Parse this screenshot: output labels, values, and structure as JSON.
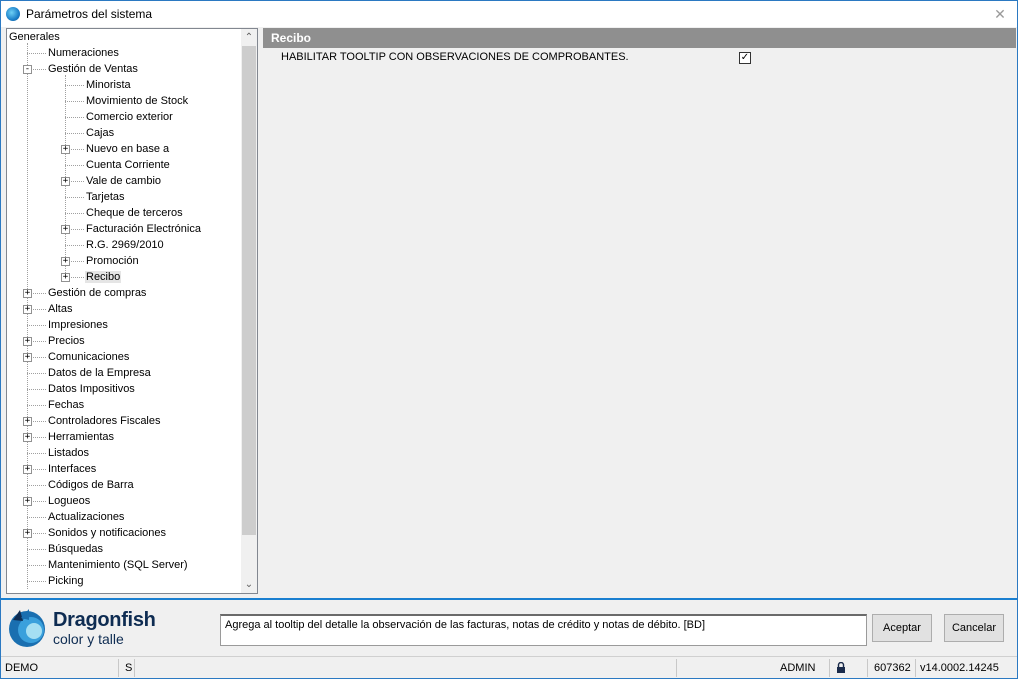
{
  "window": {
    "title": "Parámetros del sistema",
    "close_glyph": "✕"
  },
  "tree": {
    "root": "Generales",
    "items": [
      {
        "label": "Numeraciones",
        "level": 1,
        "expander": ""
      },
      {
        "label": "Gestión de Ventas",
        "level": 1,
        "expander": "−"
      },
      {
        "label": "Minorista",
        "level": 2,
        "expander": ""
      },
      {
        "label": "Movimiento de Stock",
        "level": 2,
        "expander": ""
      },
      {
        "label": "Comercio exterior",
        "level": 2,
        "expander": ""
      },
      {
        "label": "Cajas",
        "level": 2,
        "expander": ""
      },
      {
        "label": "Nuevo en base a",
        "level": 2,
        "expander": "+"
      },
      {
        "label": "Cuenta Corriente",
        "level": 2,
        "expander": ""
      },
      {
        "label": "Vale de cambio",
        "level": 2,
        "expander": "+"
      },
      {
        "label": "Tarjetas",
        "level": 2,
        "expander": ""
      },
      {
        "label": "Cheque de terceros",
        "level": 2,
        "expander": ""
      },
      {
        "label": "Facturación Electrónica",
        "level": 2,
        "expander": "+"
      },
      {
        "label": "R.G. 2969/2010",
        "level": 2,
        "expander": ""
      },
      {
        "label": "Promoción",
        "level": 2,
        "expander": "+"
      },
      {
        "label": "Recibo",
        "level": 2,
        "expander": "+",
        "selected": true
      },
      {
        "label": "Gestión de compras",
        "level": 1,
        "expander": "+"
      },
      {
        "label": "Altas",
        "level": 1,
        "expander": "+"
      },
      {
        "label": "Impresiones",
        "level": 1,
        "expander": ""
      },
      {
        "label": "Precios",
        "level": 1,
        "expander": "+"
      },
      {
        "label": "Comunicaciones",
        "level": 1,
        "expander": "+"
      },
      {
        "label": "Datos de la Empresa",
        "level": 1,
        "expander": ""
      },
      {
        "label": "Datos Impositivos",
        "level": 1,
        "expander": ""
      },
      {
        "label": "Fechas",
        "level": 1,
        "expander": ""
      },
      {
        "label": "Controladores Fiscales",
        "level": 1,
        "expander": "+"
      },
      {
        "label": "Herramientas",
        "level": 1,
        "expander": "+"
      },
      {
        "label": "Listados",
        "level": 1,
        "expander": ""
      },
      {
        "label": "Interfaces",
        "level": 1,
        "expander": "+"
      },
      {
        "label": "Códigos de Barra",
        "level": 1,
        "expander": ""
      },
      {
        "label": "Logueos",
        "level": 1,
        "expander": "+"
      },
      {
        "label": "Actualizaciones",
        "level": 1,
        "expander": ""
      },
      {
        "label": "Sonidos y notificaciones",
        "level": 1,
        "expander": "+"
      },
      {
        "label": "Búsquedas",
        "level": 1,
        "expander": ""
      },
      {
        "label": "Mantenimiento (SQL Server)",
        "level": 1,
        "expander": ""
      },
      {
        "label": "Picking",
        "level": 1,
        "expander": ""
      }
    ],
    "scroll_up_glyph": "⌃",
    "scroll_down_glyph": "⌄"
  },
  "section": {
    "header": "Recibo",
    "option_label": "HABILITAR TOOLTIP CON OBSERVACIONES DE COMPROBANTES.",
    "option_checked": true,
    "check_glyph": "✓"
  },
  "footer": {
    "brand_name": "Dragonfish",
    "brand_sub": "color y talle",
    "description": "Agrega al tooltip del detalle la observación de las facturas, notas de crédito y notas de débito. [BD]",
    "accept_label": "Aceptar",
    "cancel_label": "Cancelar"
  },
  "status": {
    "db": "DEMO",
    "mode": "S",
    "user": "ADMIN",
    "lock_icon": "lock-icon",
    "number": "607362",
    "version": "v14.0002.14245"
  },
  "colors": {
    "accent": "#1a7fd0",
    "section_header": "#8f8f8f",
    "brand": "#0e2c52"
  }
}
